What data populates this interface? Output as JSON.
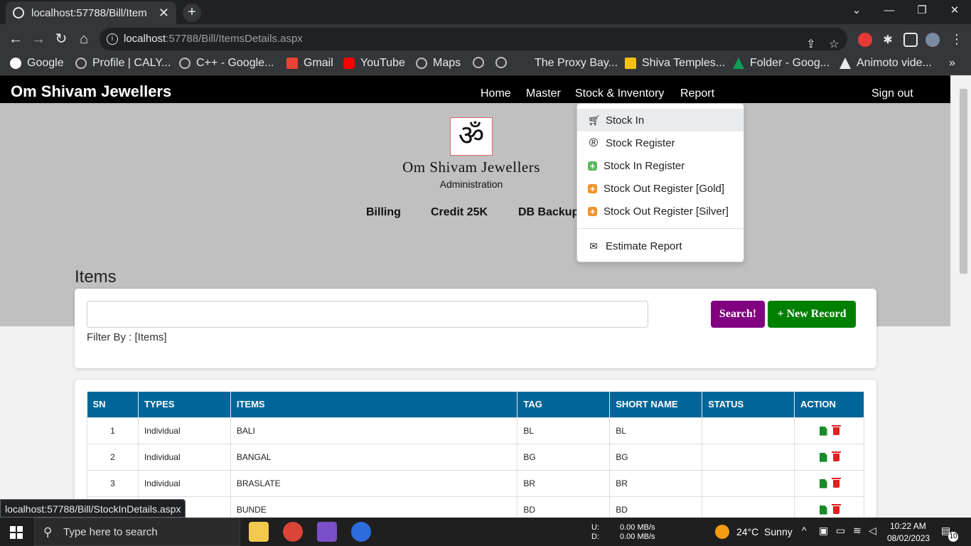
{
  "browser": {
    "tab_title": "localhost:57788/Bill/Item",
    "tab_close": "✕",
    "new_tab": "+",
    "url_host": "localhost",
    "url_rest": ":57788/Bill/ItemsDetails.aspx",
    "status_url": "localhost:57788/Bill/StockInDetails.aspx"
  },
  "bookmarks": [
    {
      "label": "Google",
      "color": "#4285f4"
    },
    {
      "label": "Profile | CALY...",
      "color": "#bdbdbd"
    },
    {
      "label": "C++ - Google...",
      "color": "#bdbdbd"
    },
    {
      "label": "Gmail",
      "color": "#ea4335"
    },
    {
      "label": "YouTube",
      "color": "#ff0000"
    },
    {
      "label": "Maps",
      "color": "#bdbdbd"
    },
    {
      "label": "",
      "color": "#bdbdbd"
    },
    {
      "label": "",
      "color": "#bdbdbd"
    },
    {
      "label": "The Proxy Bay...",
      "color": ""
    },
    {
      "label": "Shiva Temples...",
      "color": "#f4c20d"
    },
    {
      "label": "Folder - Goog...",
      "color": "#0f9d58"
    },
    {
      "label": "Animoto vide...",
      "color": "#e8eaed"
    }
  ],
  "site": {
    "brand": "Om Shivam Jewellers",
    "nav": [
      "Home",
      "Master",
      "Stock & Inventory",
      "Report"
    ],
    "signout": "Sign out",
    "logo_glyph": "ॐ",
    "org_name": "Om Shivam Jewellers",
    "org_sub": "Administration",
    "quick_links": [
      "Billing",
      "Credit 25K",
      "DB Backup"
    ]
  },
  "dropdown": {
    "items": [
      {
        "label": "Stock In",
        "icon": "cart-icon"
      },
      {
        "label": "Stock Register",
        "icon": "registered-icon"
      },
      {
        "label": "Stock In Register",
        "icon": "plus-square-icon",
        "color": "#5cb85c"
      },
      {
        "label": "Stock Out Register [Gold]",
        "icon": "plus-square-icon",
        "color": "#f0932b"
      },
      {
        "label": "Stock Out Register [Silver]",
        "icon": "plus-square-icon",
        "color": "#f0932b"
      },
      {
        "label": "Estimate Report",
        "icon": "envelope-open-icon"
      }
    ]
  },
  "items_section": {
    "title": "Items",
    "search_placeholder": "",
    "search_btn": "Search!",
    "new_btn": "+ New Record",
    "filter": "Filter By : [Items]",
    "search_btn_color": "#800080",
    "new_btn_color": "#008000"
  },
  "table": {
    "headers": [
      "SN",
      "TYPES",
      "ITEMS",
      "TAG",
      "SHORT NAME",
      "STATUS",
      "ACTION"
    ],
    "header_color": "#006699",
    "rows": [
      {
        "sn": "1",
        "type": "Individual",
        "item": "BALI",
        "tag": "BL",
        "short": "BL",
        "status": ""
      },
      {
        "sn": "2",
        "type": "Individual",
        "item": "BANGAL",
        "tag": "BG",
        "short": "BG",
        "status": ""
      },
      {
        "sn": "3",
        "type": "Individual",
        "item": "BRASLATE",
        "tag": "BR",
        "short": "BR",
        "status": ""
      },
      {
        "sn": "",
        "type": "",
        "item": "BUNDE",
        "tag": "BD",
        "short": "BD",
        "status": ""
      }
    ]
  },
  "taskbar": {
    "search": "Type here to search",
    "net_u_label": "U:",
    "net_d_label": "D:",
    "net_u": "0.00 MB/s",
    "net_d": "0.00 MB/s",
    "weather": "24°C  Sunny",
    "time": "10:22 AM",
    "date": "08/02/2023",
    "notif": "10"
  }
}
